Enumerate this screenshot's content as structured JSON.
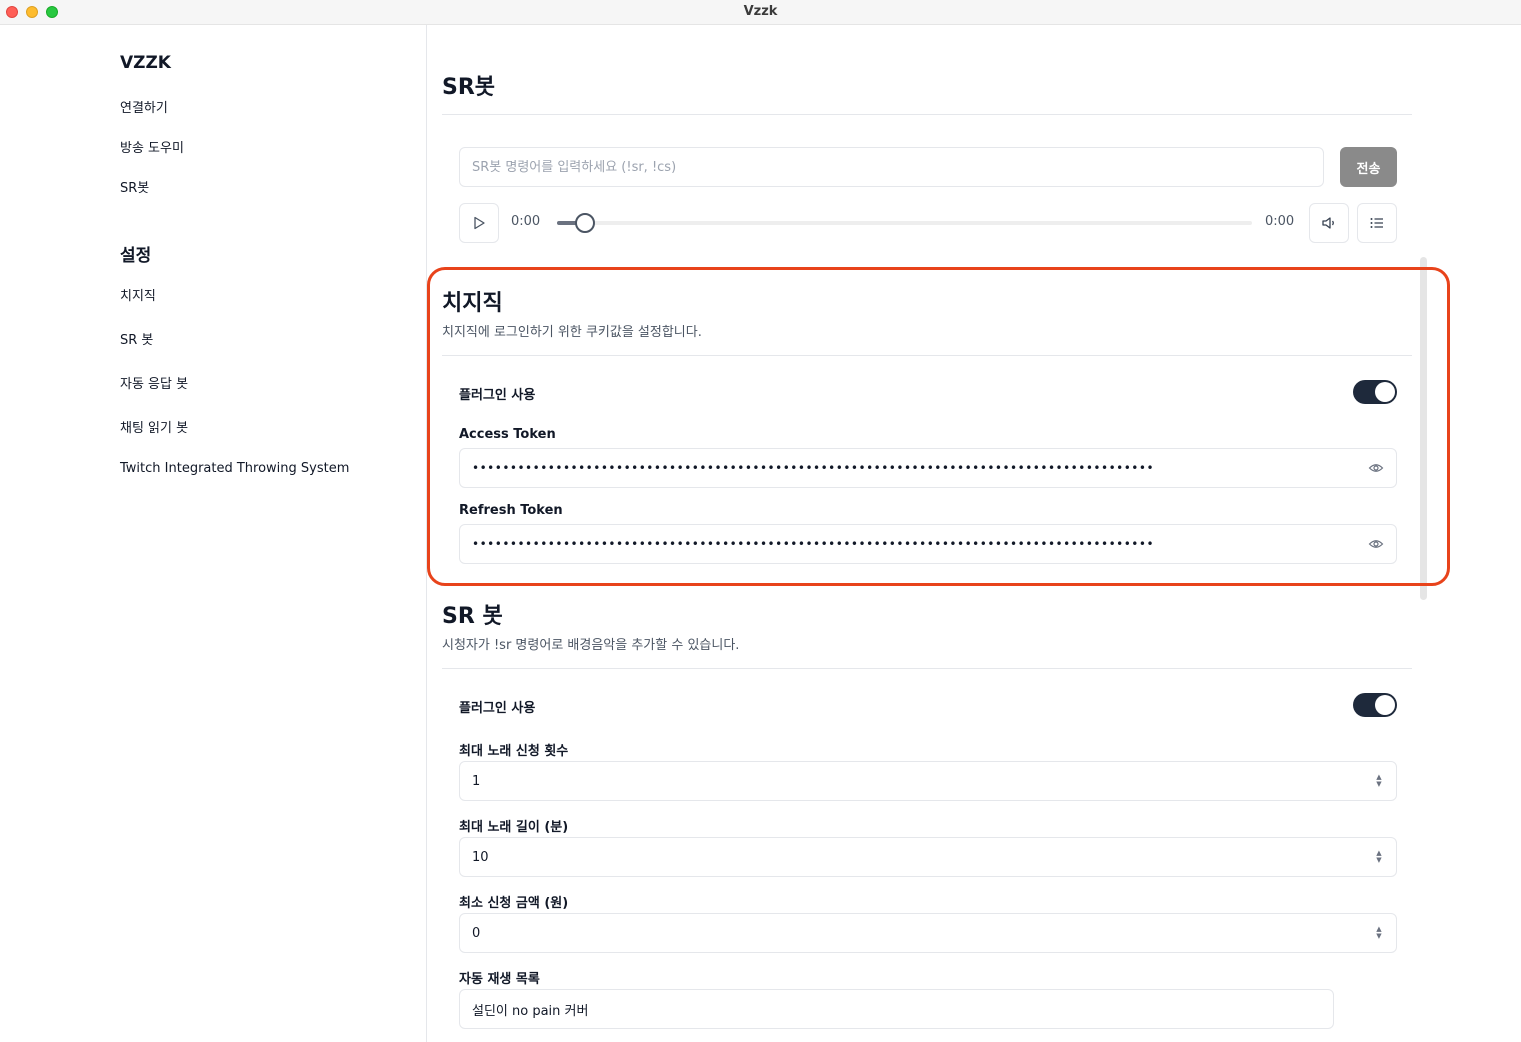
{
  "window": {
    "title": "Vzzk"
  },
  "sidebar": {
    "brand": "VZZK",
    "items": [
      {
        "label": "연결하기"
      },
      {
        "label": "방송 도우미"
      },
      {
        "label": "SR봇"
      }
    ],
    "settings_heading": "설정",
    "settings_items": [
      {
        "label": "치지직"
      },
      {
        "label": "SR 봇"
      },
      {
        "label": "자동 응답 봇"
      },
      {
        "label": "채팅 읽기 봇"
      },
      {
        "label": "Twitch Integrated Throwing System"
      }
    ]
  },
  "main": {
    "title": "SR봇",
    "command_input": {
      "placeholder": "SR봇 명령어를 입력하세요 (!sr, !cs)",
      "value": ""
    },
    "send_label": "전송",
    "player": {
      "current_time": "0:00",
      "duration": "0:00",
      "progress": 0.02
    },
    "chzzk_section": {
      "title": "치지직",
      "description": "치지직에 로그인하기 위한 쿠키값을 설정합니다.",
      "plugin_label": "플러그인 사용",
      "plugin_enabled": true,
      "access_token_label": "Access Token",
      "access_token_value": "••••••••••••••••••••••••••••••••••••••••••••••••••••••••••••••••••••••••••••••••••••••••••",
      "refresh_token_label": "Refresh Token",
      "refresh_token_value": "••••••••••••••••••••••••••••••••••••••••••••••••••••••••••••••••••••••••••••••••••••••••••"
    },
    "sr_section": {
      "title": "SR 봇",
      "description": "시청자가 !sr 명령어로 배경음악을 추가할 수 있습니다.",
      "plugin_label": "플러그인 사용",
      "plugin_enabled": true,
      "max_requests_label": "최대 노래 신청 횟수",
      "max_requests_value": "1",
      "max_length_label": "최대 노래 길이 (분)",
      "max_length_value": "10",
      "min_amount_label": "최소 신청 금액 (원)",
      "min_amount_value": "0",
      "autoplay_label": "자동 재생 목록",
      "autoplay_value": "설딘이 no pain 커버"
    }
  },
  "colors": {
    "highlight": "#e8431b",
    "toggle_on": "#1e293b",
    "send_button": "#8a8a8a"
  },
  "icons": [
    "play-icon",
    "volume-icon",
    "playlist-icon",
    "eye-icon",
    "stepper-icon"
  ]
}
